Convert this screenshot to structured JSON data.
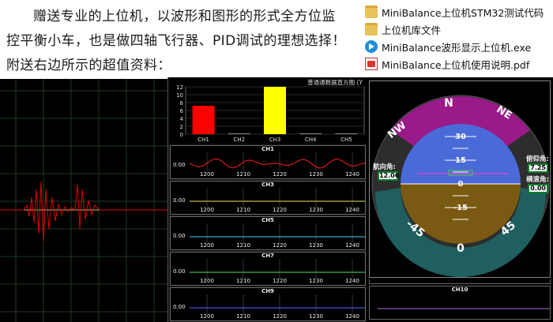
{
  "promo": {
    "line1": "赠送专业的上位机，以波形和图形的形式全方位监",
    "line2": "控平衡小车，也是做四轴飞行器、PID调试的理想选择！",
    "line3": "附送右边所示的超值资料："
  },
  "files": [
    {
      "name": "MiniBalance上位机STM32测试代码",
      "icon": "folder-icon"
    },
    {
      "name": "上位机库文件",
      "icon": "folder-icon"
    },
    {
      "name": "MiniBalance波形显示上位机.exe",
      "icon": "exe-icon"
    },
    {
      "name": "MiniBalance上位机使用说明.pdf",
      "icon": "pdf-icon"
    }
  ],
  "bar_chart": {
    "title": "普通通数据直方图",
    "title_suffix": "(Y",
    "yticks": [
      "12",
      "10",
      "8",
      "6",
      "4",
      "2",
      "0"
    ],
    "categories": [
      "CH1",
      "CH2",
      "CH3",
      "CH4",
      "CH5"
    ],
    "values": [
      7.2,
      0,
      12,
      0,
      0
    ],
    "colors": [
      "#ff0000",
      "#888888",
      "#ffff00",
      "#888888",
      "#888888"
    ],
    "ymax": 12
  },
  "strips": [
    {
      "name": "CH1",
      "zero": "0.00",
      "ticks": [
        "1200",
        "1210",
        "1220",
        "1230",
        "1240"
      ],
      "color": "#ff2020",
      "wave": "sine"
    },
    {
      "name": "CH3",
      "zero": "0.00",
      "ticks": [
        "1200",
        "1210",
        "1220",
        "1230",
        "1240"
      ],
      "color": "#e8e84a",
      "wave": "flat"
    },
    {
      "name": "CH5",
      "zero": "0.00",
      "ticks": [
        "1200",
        "1210",
        "1220",
        "1230",
        "1240"
      ],
      "color": "#3bd3e8",
      "wave": "flat"
    },
    {
      "name": "CH7",
      "zero": "0.00",
      "ticks": [
        "1200",
        "1210",
        "1220",
        "1230",
        "1240"
      ],
      "color": "#5be06a",
      "wave": "flat"
    },
    {
      "name": "CH9",
      "zero": "0.00",
      "ticks": [
        "1200",
        "1210",
        "1220",
        "1230",
        "1240"
      ],
      "color": "#4b6bff",
      "wave": "flat"
    }
  ],
  "hud": {
    "compass": [
      "NW",
      "N",
      "NE"
    ],
    "pitch_labels": [
      "30",
      "15",
      "0",
      "-15"
    ],
    "roll_labels": [
      "-45",
      "0",
      "45"
    ],
    "left_label": "航向角:",
    "left_value": "12.06",
    "right_label_1": "俯仰角:",
    "right_value_1": "7.25",
    "right_label_2": "横滚角:",
    "right_value_2": "0.00",
    "sky_color": "#4a6ad8",
    "ground_color": "#7a5a12",
    "band_color": "#9a1a8a",
    "lower_band_color": "#1f5f5f"
  },
  "right_strips": [
    {
      "name": "",
      "color": "#9a6bd8"
    },
    {
      "name": "CH10",
      "color": "#b46bd8"
    }
  ]
}
